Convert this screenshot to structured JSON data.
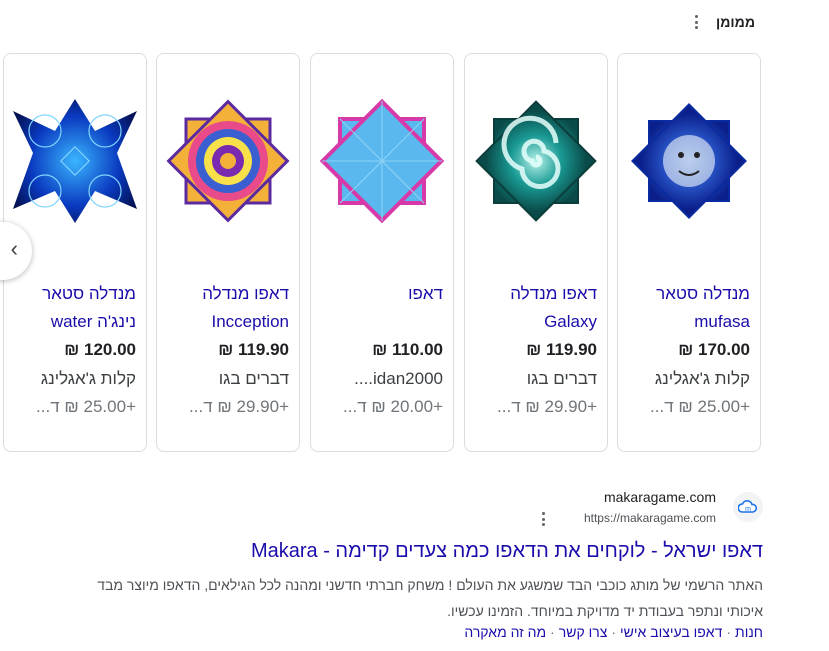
{
  "header": {
    "sponsored_label": "ממומן"
  },
  "products": [
    {
      "title": "מנדלה סטאר mufasa",
      "price": "170.00 ₪",
      "merchant": "קלות ג'אגלינג",
      "shipping": "+25.00 ₪ ד...",
      "image_icon": "blue-lion-star-kite"
    },
    {
      "title": "דאפו מנדלה Galaxy",
      "price": "119.90 ₪",
      "merchant": "דברים בגו",
      "shipping": "+29.90 ₪ ד...",
      "image_icon": "teal-spiral-star-kite"
    },
    {
      "title": "דאפו",
      "price": "110.00 ₪",
      "merchant": "idan2000....",
      "shipping": "+20.00 ₪ ד...",
      "image_icon": "light-blue-pink-star-kite"
    },
    {
      "title": "דאפו מנדלה Incception",
      "price": "119.90 ₪",
      "merchant": "דברים בגו",
      "shipping": "+29.90 ₪ ד...",
      "image_icon": "psychedelic-spiral-star-kite"
    },
    {
      "title": "מנדלה סטאר נינג'ה water",
      "price": "120.00 ₪",
      "merchant": "קלות ג'אגלינג",
      "shipping": "+25.00 ₪ ד...",
      "image_icon": "blue-water-square-kite"
    }
  ],
  "carousel": {
    "prev_icon": "chevron-left-icon"
  },
  "result": {
    "site_name": "makaragame.com",
    "url": "https://makaragame.com",
    "title": "דאפו ישראל - לוקחים את הדאפו כמה צעדים קדימה - Makara",
    "snippet": "האתר הרשמי של מותג כוכבי הבד שמשגע את העולם ! משחק חברתי חדשני ומהנה לכל הגילאים, הדאפו מיוצר מבד איכותי ונתפר בעבודת יד מדויקת במיוחד. הזמינו עכשיו.",
    "sitelinks": [
      "חנות",
      "דאפו בעיצוב אישי",
      "צרו קשר",
      "מה זה מאקרה"
    ]
  },
  "colors": {
    "link": "#1a0dab",
    "text": "#202124",
    "muted": "#70757a"
  }
}
